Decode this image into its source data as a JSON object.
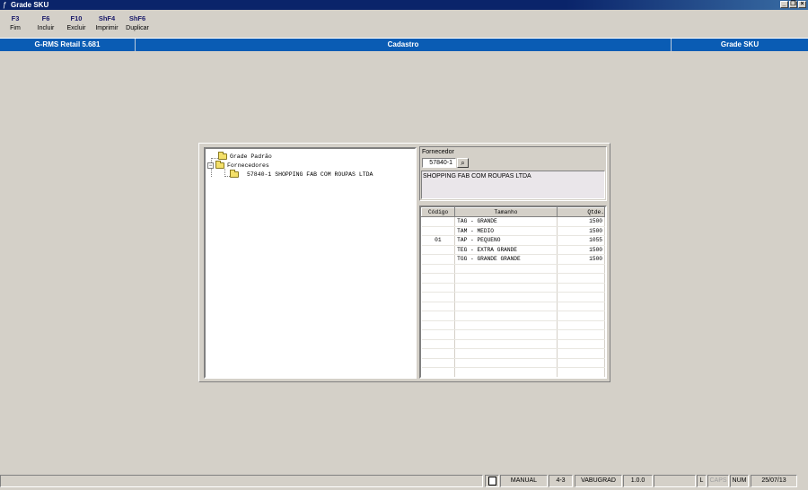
{
  "window": {
    "title": "Grade SKU",
    "controls": {
      "minimize": "_",
      "restore": "❐",
      "close": "×"
    }
  },
  "fkeys": [
    {
      "key": "F3",
      "label": "Fim"
    },
    {
      "key": "F6",
      "label": "Incluir"
    },
    {
      "key": "F10",
      "label": "Excluir"
    },
    {
      "key": "ShF4",
      "label": "Imprimir"
    },
    {
      "key": "ShF6",
      "label": "Duplicar"
    }
  ],
  "infobar": {
    "app": "G-RMS Retail 5.681",
    "module": "Cadastro",
    "screen": "Grade SKU"
  },
  "tree": {
    "root1": "Grade Padrão",
    "root2": "Fornecedores",
    "child": "57840-1 SHOPPING FAB COM ROUPAS LTDA",
    "expander": "−"
  },
  "fornecedor": {
    "label": "Fornecedor",
    "code": "57840-1",
    "search_icon": "binoculars-icon",
    "name": "SHOPPING FAB COM ROUPAS LTDA"
  },
  "grid": {
    "headers": [
      "Código",
      "Tamanho",
      "Qtde."
    ],
    "rows": [
      [
        "",
        "TAG - GRANDE",
        "1500"
      ],
      [
        "",
        "TAM - MEDIO",
        "1500"
      ],
      [
        "01",
        "TAP - PEQUENO",
        "1055"
      ],
      [
        "",
        "TEG - EXTRA GRANDE",
        "1500"
      ],
      [
        "",
        "TGG - GRANDE GRANDE",
        "1500"
      ]
    ]
  },
  "statusbar": {
    "mode": "MANUAL",
    "field1": "4-3",
    "program": "VABUGRAD",
    "version": "1.0.0",
    "l": "L",
    "caps": "CAPS",
    "num": "NUM",
    "date": "25/07/13"
  }
}
